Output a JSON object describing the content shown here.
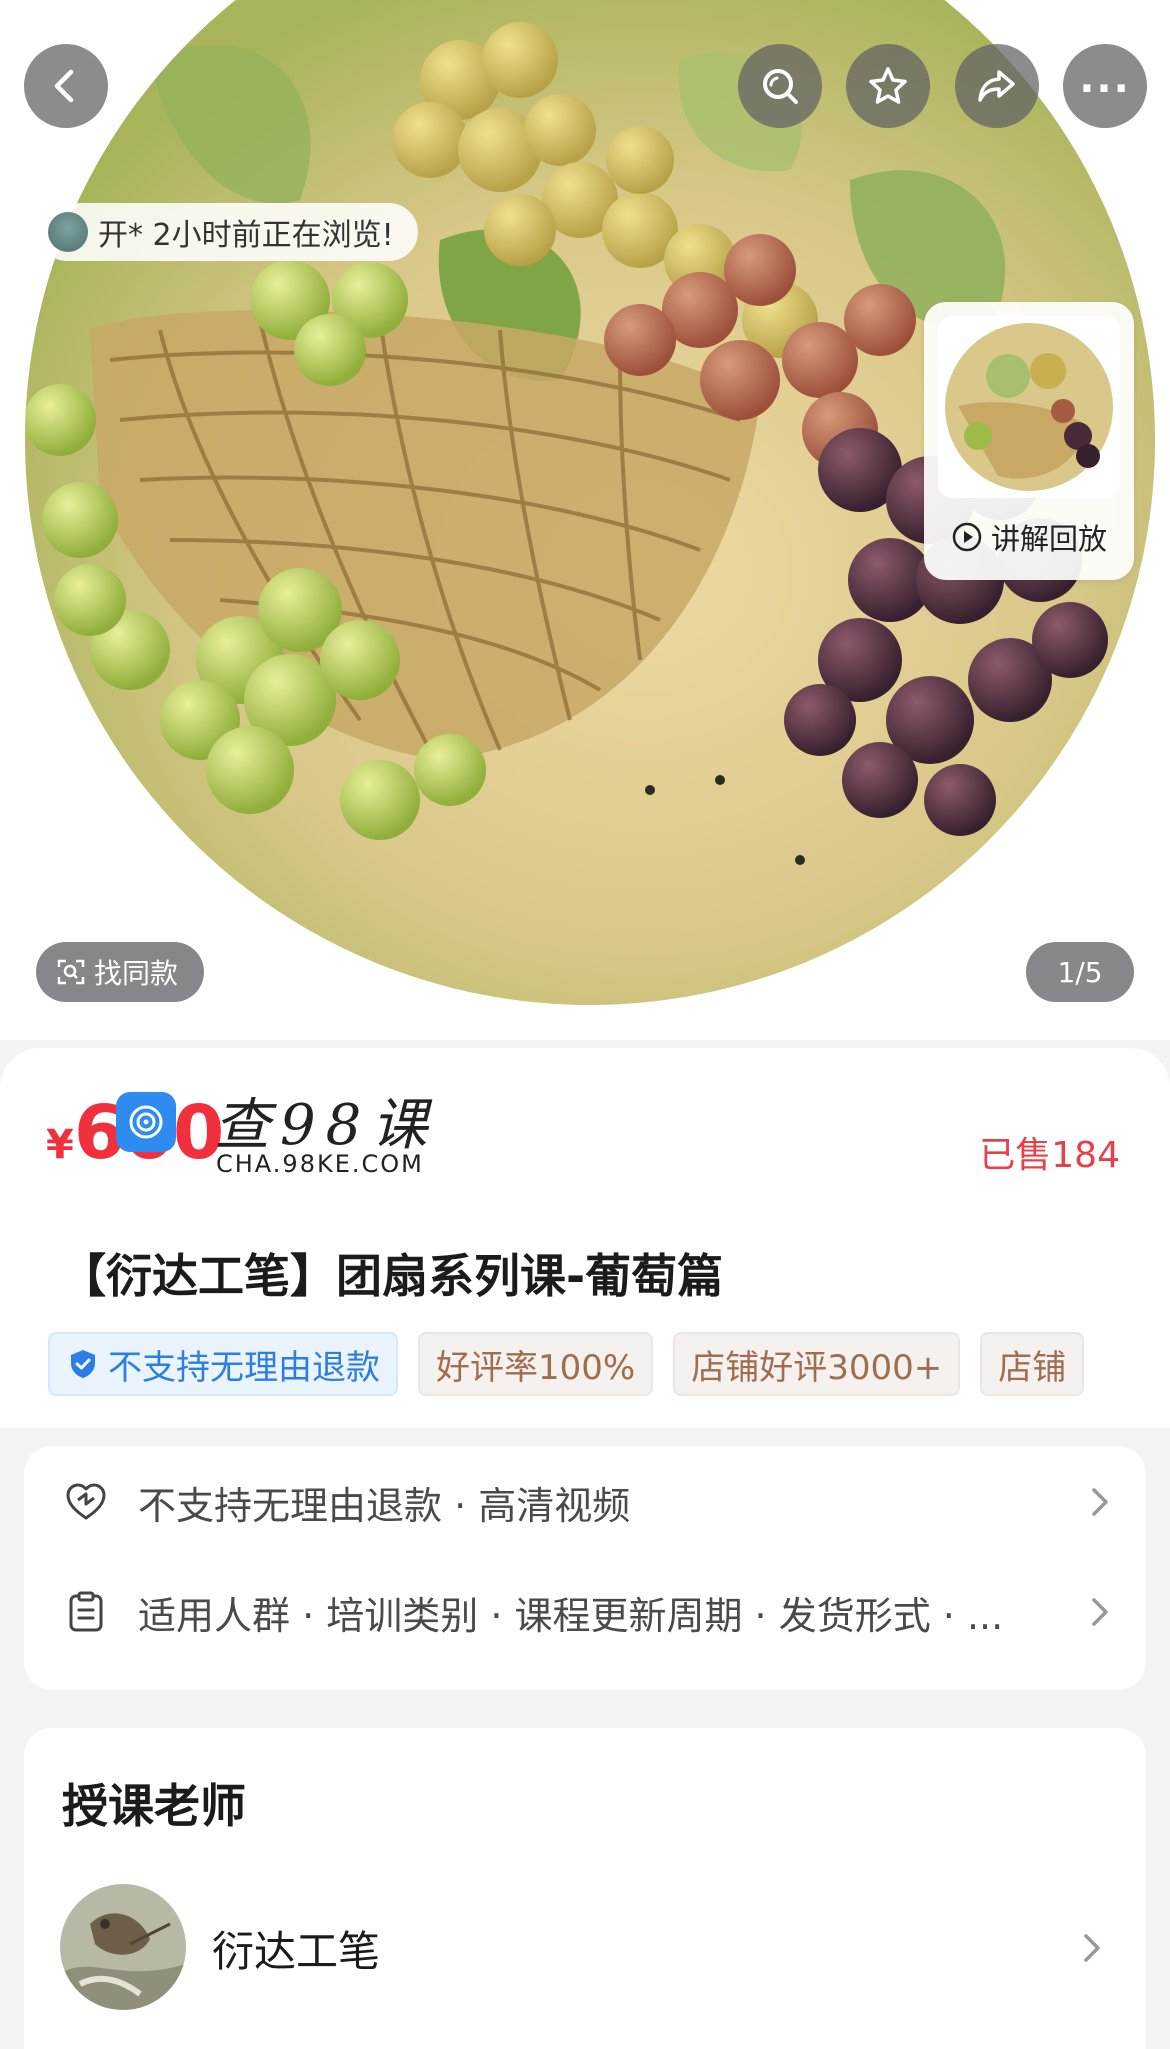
{
  "top_bar": {
    "back_icon": "chevron-left-icon",
    "search_icon": "search-icon",
    "favorite_icon": "star-icon",
    "share_icon": "share-icon",
    "more_label": "..."
  },
  "browse_notice": {
    "text": "开* 2小时前正在浏览!"
  },
  "replay": {
    "label": "讲解回放",
    "icon": "play-circle-icon"
  },
  "find_same": {
    "label": "找同款",
    "icon": "scan-icon"
  },
  "gallery": {
    "indicator": "1/5",
    "current": 1,
    "total": 5
  },
  "price": {
    "currency": "¥",
    "value": "600"
  },
  "watermark": {
    "title": "查98课",
    "url": "CHA.98KE.COM"
  },
  "sold": {
    "text": "已售184"
  },
  "product": {
    "title": "【衍达工笔】团扇系列课-葡萄篇"
  },
  "tags": [
    {
      "label": "不支持无理由退款",
      "style": "blue",
      "icon": "shield-check-icon"
    },
    {
      "label": "好评率100%",
      "style": "brown"
    },
    {
      "label": "店铺好评3000+",
      "style": "brown"
    },
    {
      "label": "店铺",
      "style": "brown"
    }
  ],
  "services": [
    {
      "icon": "heart-shield-icon",
      "text": "不支持无理由退款 · 高清视频"
    },
    {
      "icon": "clipboard-icon",
      "text": "适用人群 · 培训类别 · 课程更新周期 · 发货形式 · ..."
    }
  ],
  "teacher": {
    "heading": "授课老师",
    "name": "衍达工笔"
  },
  "colors": {
    "accent_red": "#f0303d",
    "tag_blue": "#2d7de6",
    "tag_brown": "#a06d4e"
  }
}
